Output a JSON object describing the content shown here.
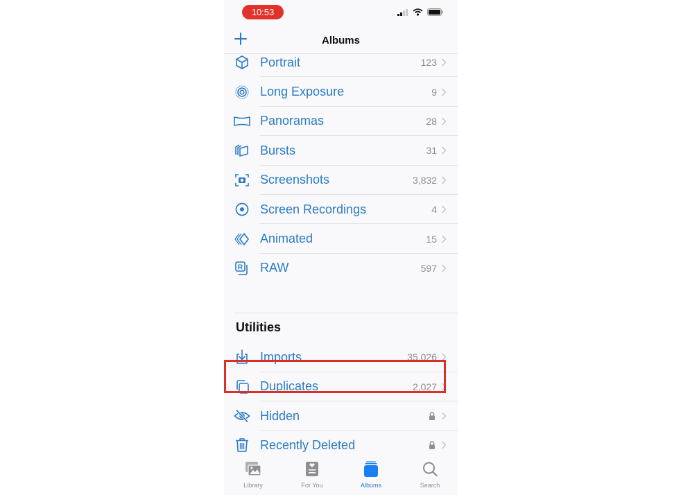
{
  "status_bar": {
    "time": "10:53"
  },
  "nav": {
    "title": "Albums",
    "add_icon": "plus-icon"
  },
  "colors": {
    "accent": "#2b7bc4",
    "time_pill": "#e0322b",
    "highlight": "#d9302a",
    "tab_active": "#1a7ef5"
  },
  "media_types": [
    {
      "label": "Portrait",
      "count": "123",
      "icon": "cube-icon"
    },
    {
      "label": "Long Exposure",
      "count": "9",
      "icon": "long-exposure-icon"
    },
    {
      "label": "Panoramas",
      "count": "28",
      "icon": "panorama-icon"
    },
    {
      "label": "Bursts",
      "count": "31",
      "icon": "bursts-icon"
    },
    {
      "label": "Screenshots",
      "count": "3,832",
      "icon": "screenshot-icon"
    },
    {
      "label": "Screen Recordings",
      "count": "4",
      "icon": "screen-recording-icon"
    },
    {
      "label": "Animated",
      "count": "15",
      "icon": "animated-icon"
    },
    {
      "label": "RAW",
      "count": "597",
      "icon": "raw-icon"
    }
  ],
  "utilities": {
    "title": "Utilities",
    "items": [
      {
        "label": "Imports",
        "count": "35,026",
        "icon": "import-icon"
      },
      {
        "label": "Duplicates",
        "count": "2,027",
        "icon": "duplicates-icon",
        "highlighted": true
      },
      {
        "label": "Hidden",
        "count": "",
        "icon": "hidden-eye-icon",
        "locked": true
      },
      {
        "label": "Recently Deleted",
        "count": "",
        "icon": "trash-icon",
        "locked": true
      }
    ]
  },
  "tabs": [
    {
      "label": "Library",
      "icon": "library-icon",
      "active": false
    },
    {
      "label": "For You",
      "icon": "for-you-icon",
      "active": false
    },
    {
      "label": "Albums",
      "icon": "albums-icon",
      "active": true
    },
    {
      "label": "Search",
      "icon": "search-icon",
      "active": false
    }
  ]
}
